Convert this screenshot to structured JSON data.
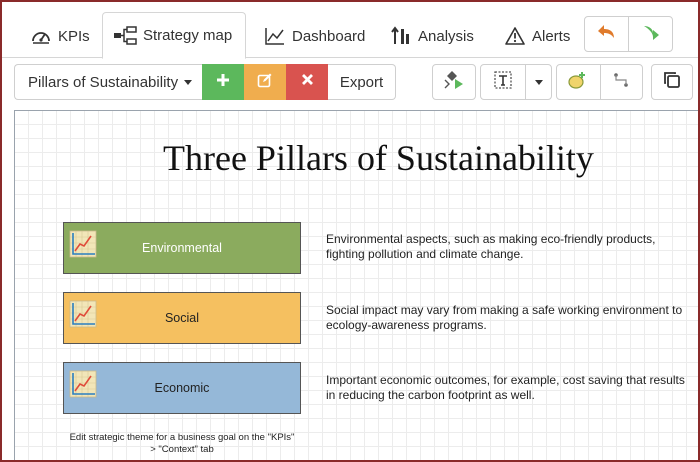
{
  "tabs": [
    {
      "label": "KPIs",
      "icon": "gauge-icon"
    },
    {
      "label": "Strategy map",
      "icon": "strategy-map-icon",
      "active": true
    },
    {
      "label": "Dashboard",
      "icon": "line-chart-icon"
    },
    {
      "label": "Analysis",
      "icon": "sort-amount-icon"
    },
    {
      "label": "Alerts",
      "icon": "warning-icon"
    }
  ],
  "history": {
    "undo_icon": "undo-icon",
    "redo_icon": "redo-icon"
  },
  "toolbar": {
    "theme_selector": "Pillars of Sustainability",
    "export_label": "Export"
  },
  "map": {
    "title": "Three Pillars of Sustainability",
    "pillars": [
      {
        "label": "Environmental",
        "description": "Environmental aspects, such as making eco-friendly products, fighting pollution and climate change.",
        "color": "#8bab5e"
      },
      {
        "label": "Social",
        "description": "Social impact may vary from making a safe working environment to ecology-awareness programs.",
        "color": "#f5c060"
      },
      {
        "label": "Economic",
        "description": "Important economic outcomes, for example, cost saving that results in reducing the carbon footprint as well.",
        "color": "#95b8d8"
      }
    ],
    "footnote": "Edit strategic theme for a business goal on the \"KPIs\" > \"Context\" tab"
  },
  "colors": {
    "add": "#5cb85c",
    "edit": "#f0ad4e",
    "delete": "#d9534f",
    "frame": "#8a2a2a",
    "undo": "#e07b2c",
    "redo": "#5cb85c"
  }
}
